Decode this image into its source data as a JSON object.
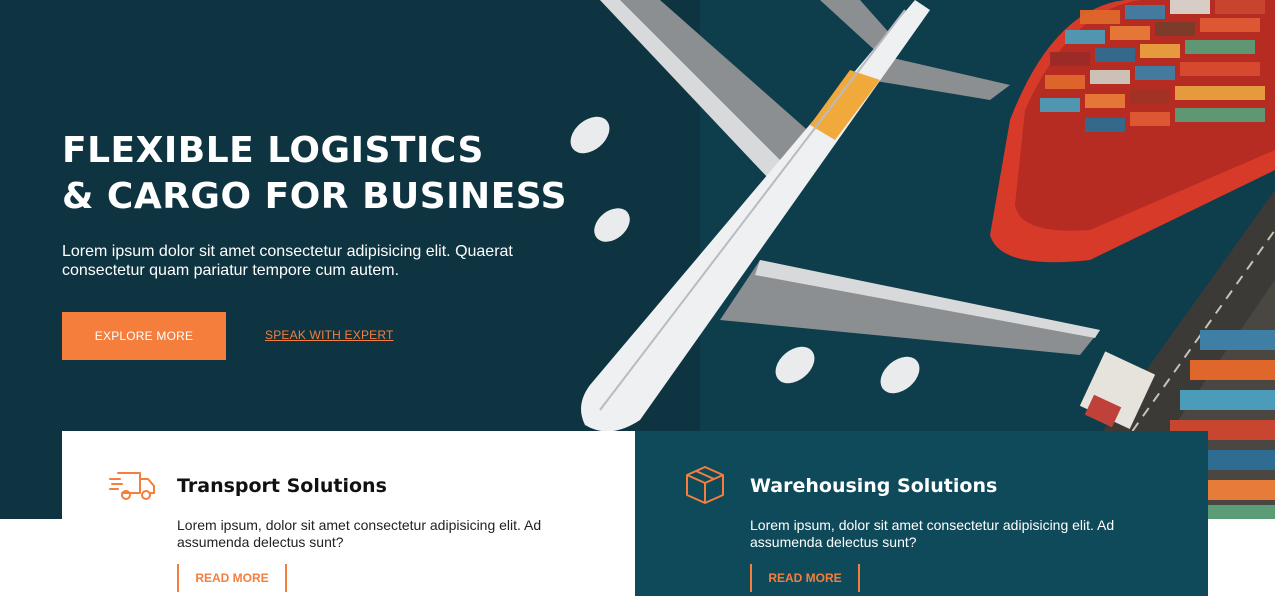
{
  "hero": {
    "title_line1": "FLEXIBLE LOGISTICS",
    "title_line2": "& CARGO FOR BUSINESS",
    "subtitle": "Lorem ipsum dolor sit amet consectetur adipisicing elit. Quaerat consectetur quam pariatur tempore cum autem.",
    "primary_button": "EXPLORE MORE",
    "secondary_link": "SPEAK WITH EXPERT",
    "image": "airplane-over-cargo-ship-photo"
  },
  "services": [
    {
      "icon": "delivery-truck-icon",
      "title": "Transport Solutions",
      "text": "Lorem ipsum, dolor sit amet consectetur adipisicing elit. Ad assumenda delectus sunt?",
      "button": "READ MORE"
    },
    {
      "icon": "box-icon",
      "title": "Warehousing Solutions",
      "text": "Lorem ipsum, dolor sit amet consectetur adipisicing elit. Ad assumenda delectus sunt?",
      "button": "READ MORE"
    }
  ],
  "colors": {
    "accent": "#f57e3d",
    "hero_background": "#0d2f3a",
    "dark_card": "#0f4a5b"
  }
}
